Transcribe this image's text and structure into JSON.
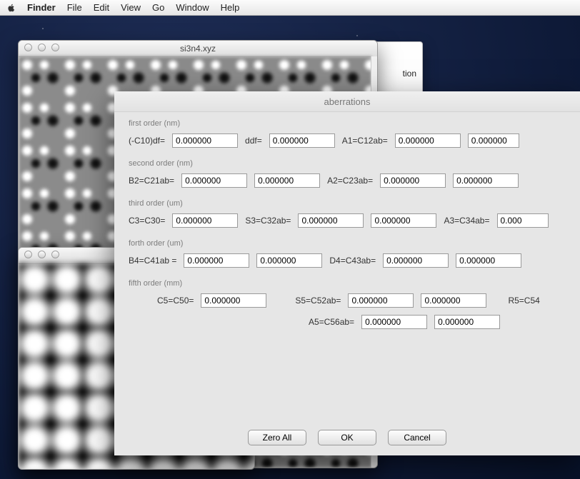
{
  "menubar": {
    "app": "Finder",
    "items": [
      "File",
      "Edit",
      "View",
      "Go",
      "Window",
      "Help"
    ]
  },
  "window_si3n4": {
    "title": "si3n4.xyz"
  },
  "peek": {
    "visible_text": "tion"
  },
  "dialog": {
    "title": "aberrations",
    "groups": {
      "first": {
        "label": "first order (nm)",
        "c10df_lbl": "(-C10)df=",
        "c10df": "0.000000",
        "ddf_lbl": "ddf=",
        "ddf": "0.000000",
        "a1_lbl": "A1=C12ab=",
        "a1a": "0.000000",
        "a1b": "0.000000"
      },
      "second": {
        "label": "second order (nm)",
        "b2_lbl": "B2=C21ab=",
        "b2a": "0.000000",
        "b2b": "0.000000",
        "a2_lbl": "A2=C23ab=",
        "a2a": "0.000000",
        "a2b": "0.000000"
      },
      "third": {
        "label": "third order (um)",
        "c3_lbl": "C3=C30=",
        "c3": "0.000000",
        "s3_lbl": "S3=C32ab=",
        "s3a": "0.000000",
        "s3b": "0.000000",
        "a3_lbl": "A3=C34ab=",
        "a3": "0.000"
      },
      "forth": {
        "label": "forth order (um)",
        "b4_lbl": "B4=C41ab =",
        "b4a": "0.000000",
        "b4b": "0.000000",
        "d4_lbl": "D4=C43ab=",
        "d4a": "0.000000",
        "d4b": "0.000000"
      },
      "fifth": {
        "label": "fifth order (mm)",
        "c5_lbl": "C5=C50=",
        "c5": "0.000000",
        "s5_lbl": "S5=C52ab=",
        "s5a": "0.000000",
        "s5b": "0.000000",
        "r5_lbl": "R5=C54",
        "a5_lbl": "A5=C56ab=",
        "a5a": "0.000000",
        "a5b": "0.000000"
      }
    },
    "buttons": {
      "zero_all": "Zero All",
      "ok": "OK",
      "cancel": "Cancel"
    }
  }
}
